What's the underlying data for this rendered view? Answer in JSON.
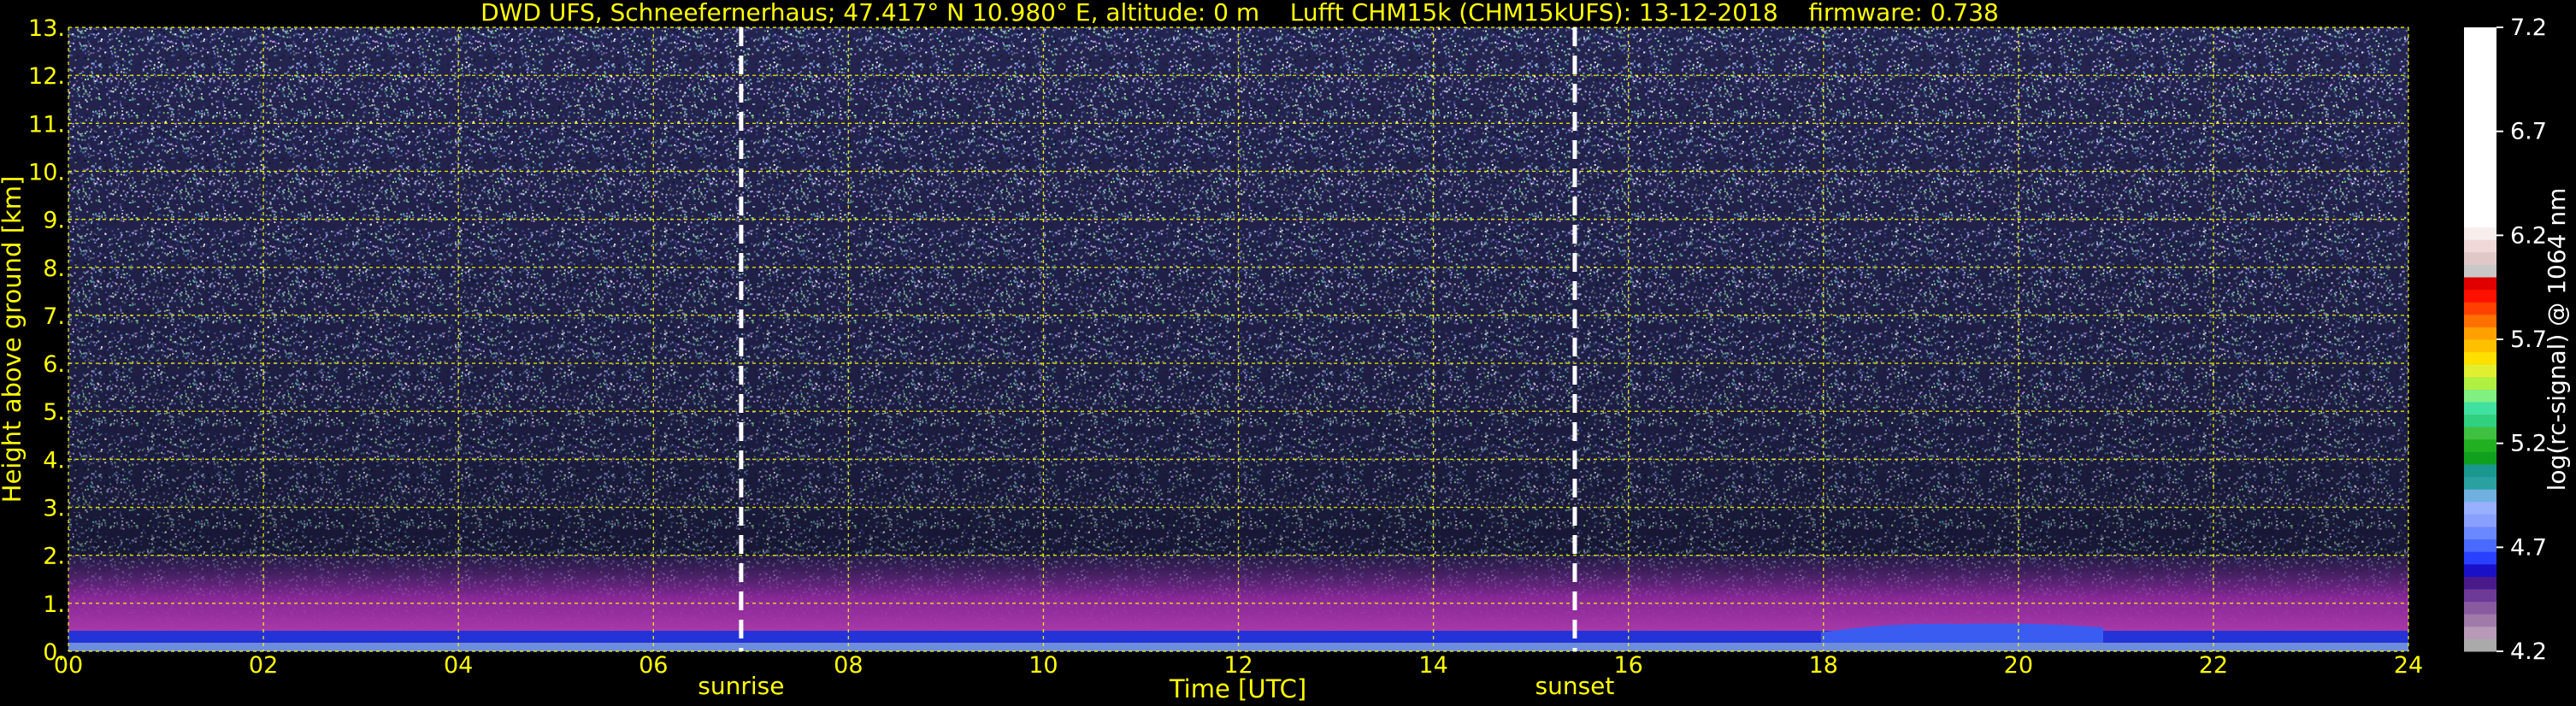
{
  "chart_data": {
    "type": "heatmap",
    "title": "DWD UFS, Schneefernerhaus; 47.417° N 10.980° E, altitude: 0 m    Lufft CHM15k (CHM15kUFS): 13-12-2018    firmware: 0.738",
    "xlabel": "Time [UTC]",
    "ylabel": "Height above ground [km]",
    "xlim": [
      0,
      24
    ],
    "ylim": [
      0,
      13
    ],
    "x_ticks": [
      "00",
      "02",
      "04",
      "06",
      "08",
      "10",
      "12",
      "14",
      "16",
      "18",
      "20",
      "22",
      "24"
    ],
    "y_ticks": [
      "0.",
      "1.",
      "2.",
      "3.",
      "4.",
      "5.",
      "6.",
      "7.",
      "8.",
      "9.",
      "10.",
      "11.",
      "12.",
      "13."
    ],
    "grid": true,
    "events": [
      {
        "label": "sunrise",
        "time": 6.9
      },
      {
        "label": "sunset",
        "time": 15.45
      }
    ],
    "colorbar": {
      "label": "log(rc-signal) @ 1064 nm",
      "ticks": [
        "4.2",
        "4.7",
        "5.2",
        "5.7",
        "6.2",
        "6.7",
        "7.2"
      ],
      "range": [
        4.2,
        7.2
      ]
    }
  },
  "colors": {
    "text": "#ffff00",
    "grid": "#ffff00",
    "background": "#000000",
    "noise_base": "#2a2a55",
    "aerosol_layer": "#8a2a9e",
    "surface_layer": "#2433d8"
  }
}
